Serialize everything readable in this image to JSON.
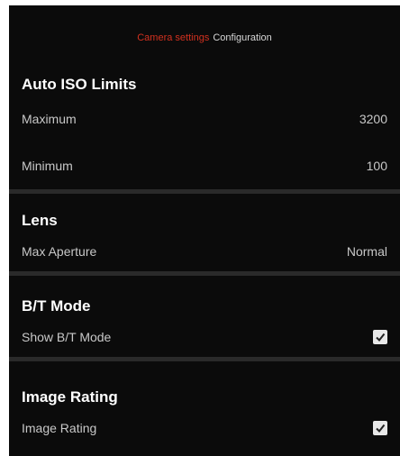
{
  "breadcrumb": {
    "parent": "Camera settings",
    "current": "Configuration"
  },
  "sections": {
    "auto_iso": {
      "title": "Auto ISO Limits",
      "maximum": {
        "label": "Maximum",
        "value": "3200"
      },
      "minimum": {
        "label": "Minimum",
        "value": "100"
      }
    },
    "lens": {
      "title": "Lens",
      "max_aperture": {
        "label": "Max Aperture",
        "value": "Normal"
      }
    },
    "bt_mode": {
      "title": "B/T Mode",
      "show_bt_mode": {
        "label": "Show B/T Mode",
        "checked": true,
        "icon": "checkmark-icon"
      }
    },
    "image_rating": {
      "title": "Image Rating",
      "image_rating": {
        "label": "Image Rating",
        "checked": true,
        "icon": "checkmark-icon"
      }
    }
  },
  "colors": {
    "background": "#0b0b0b",
    "accent": "#d2311f",
    "divider": "#2a2a2a"
  }
}
